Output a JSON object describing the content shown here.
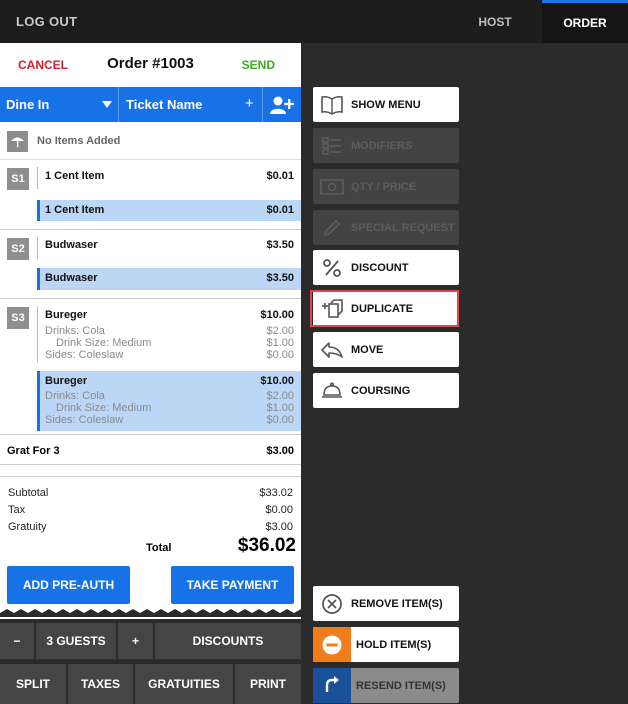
{
  "topbar": {
    "logout_label": "LOG OUT",
    "tabs": [
      {
        "label": "HOST"
      },
      {
        "label": "ORDER"
      }
    ]
  },
  "order": {
    "cancel_label": "CANCEL",
    "title": "Order #1003",
    "send_label": "SEND"
  },
  "bluebar": {
    "dine_in": "Dine In",
    "ticket_name": "Ticket Name",
    "plus": "+"
  },
  "no_items": "No Items Added",
  "seats": [
    {
      "badge": "S1",
      "item": "1 Cent Item",
      "price": "$0.01",
      "selected": {
        "item": "1 Cent Item",
        "price": "$0.01"
      }
    },
    {
      "badge": "S2",
      "item": "Budwaser",
      "price": "$3.50",
      "selected": {
        "item": "Budwaser",
        "price": "$3.50"
      }
    },
    {
      "badge": "S3",
      "item": "Bureger",
      "price": "$10.00",
      "modifiers": [
        {
          "label": "Drinks: Cola",
          "price": "$2.00"
        },
        {
          "label": "Drink Size: Medium",
          "price": "$1.00"
        },
        {
          "label": "Sides: Coleslaw",
          "price": "$0.00"
        }
      ],
      "selected": {
        "item": "Bureger",
        "price": "$10.00",
        "modifiers": [
          {
            "label": "Drinks: Cola",
            "price": "$2.00"
          },
          {
            "label": "Drink Size: Medium",
            "price": "$1.00"
          },
          {
            "label": "Sides: Coleslaw",
            "price": "$0.00"
          }
        ]
      }
    }
  ],
  "grat": {
    "label": "Grat For 3",
    "value": "$3.00"
  },
  "totals": {
    "subtotal_label": "Subtotal",
    "subtotal": "$33.02",
    "tax_label": "Tax",
    "tax": "$0.00",
    "gratuity_label": "Gratuity",
    "gratuity": "$3.00",
    "total_label": "Total",
    "total": "$36.02"
  },
  "payment": {
    "preauth_label": "ADD PRE-AUTH",
    "take_payment_label": "TAKE PAYMENT"
  },
  "bottom": {
    "minus": "−",
    "guests": "3 GUESTS",
    "plus": "+",
    "discounts": "DISCOUNTS",
    "split": "SPLIT",
    "taxes": "TAXES",
    "gratuities": "GRATUITIES",
    "print": "PRINT"
  },
  "actions": [
    {
      "label": "SHOW MENU",
      "icon": "book-icon",
      "enabled": true
    },
    {
      "label": "MODIFIERS",
      "icon": "list-icon",
      "enabled": false
    },
    {
      "label": "QTY / PRICE",
      "icon": "cash-icon",
      "enabled": false
    },
    {
      "label": "SPECIAL REQUEST",
      "icon": "pencil-icon",
      "enabled": false
    },
    {
      "label": "DISCOUNT",
      "icon": "percent-icon",
      "enabled": true
    },
    {
      "label": "DUPLICATE",
      "icon": "duplicate-icon",
      "enabled": true
    },
    {
      "label": "MOVE",
      "icon": "move-arrow-icon",
      "enabled": true
    },
    {
      "label": "COURSING",
      "icon": "cloche-icon",
      "enabled": true
    }
  ],
  "item_actions": [
    {
      "label": "REMOVE ITEM(S)",
      "icon": "x-circle-icon",
      "enabled": true
    },
    {
      "label": "HOLD ITEM(S)",
      "icon": "minus-circle-icon",
      "enabled": true,
      "accent": "#f07d1a"
    },
    {
      "label": "RESEND ITEM(S)",
      "icon": "resend-icon",
      "enabled": false,
      "accent": "#1672e6"
    }
  ],
  "colors": {
    "accent_blue": "#1672e6",
    "cancel_red": "#d0202e",
    "send_green": "#3aaa1e",
    "highlight_red": "#e5434e"
  }
}
